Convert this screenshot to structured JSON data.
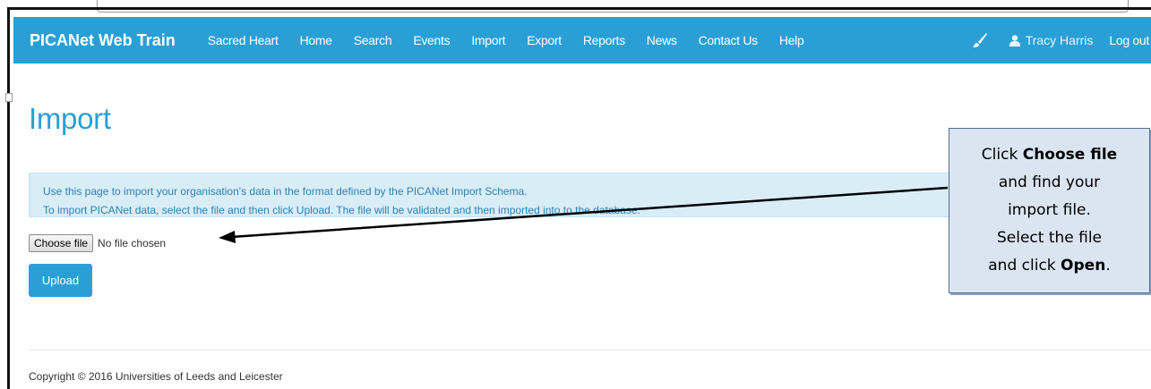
{
  "navbar": {
    "brand": "PICANet Web Train",
    "items": [
      "Sacred Heart",
      "Home",
      "Search",
      "Events",
      "Import",
      "Export",
      "Reports",
      "News",
      "Contact Us",
      "Help"
    ],
    "user": "Tracy Harris",
    "logout": "Log out",
    "color": "#2a9fd6"
  },
  "page": {
    "title": "Import",
    "info_line1": "Use this page to import your organisation's data in the format defined by the PICANet Import Schema.",
    "info_line2": "To import PICANet data, select the file and then click Upload. The file will be validated and then imported into to the database.",
    "choose_file_label": "Choose file",
    "no_file_text": "No file chosen",
    "upload_label": "Upload",
    "copyright": "Copyright © 2016 Universities of Leeds and Leicester"
  },
  "callout": {
    "l1_pre": "Click ",
    "l1_bold": "Choose file",
    "l2": "and find your",
    "l3": "import file.",
    "l4": "Select the file",
    "l5_pre": "and click ",
    "l5_bold": "Open",
    "l5_post": "."
  }
}
